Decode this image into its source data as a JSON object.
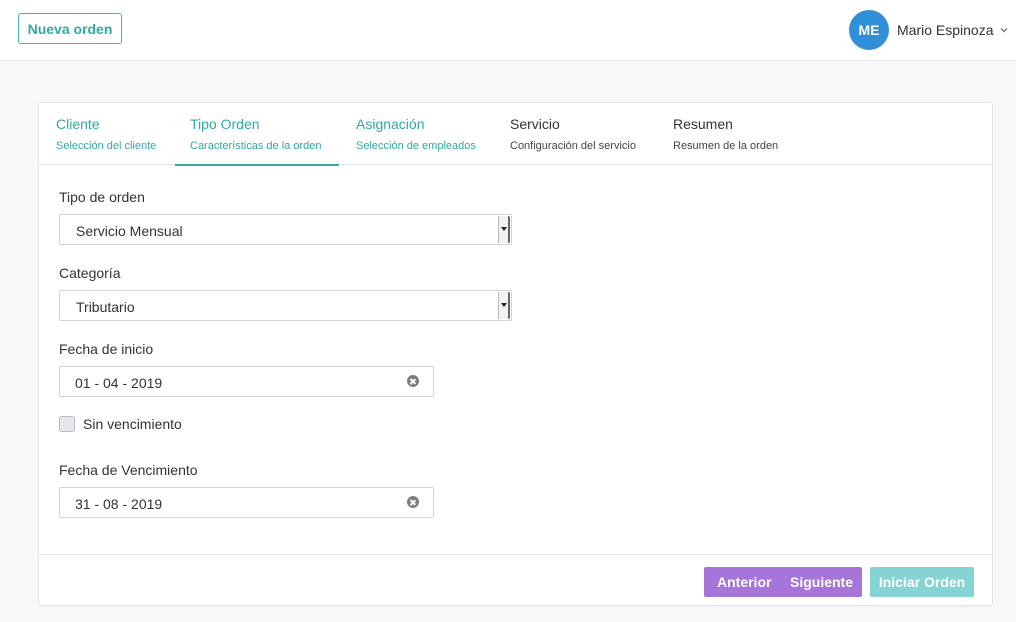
{
  "header": {
    "new_order_label": "Nueva orden",
    "user": {
      "initials": "ME",
      "name": "Mario Espinoza"
    }
  },
  "steps": [
    {
      "title": "Cliente",
      "subtitle": "Selección del cliente",
      "state": "done"
    },
    {
      "title": "Tipo Orden",
      "subtitle": "Características de la orden",
      "state": "active"
    },
    {
      "title": "Asignación",
      "subtitle": "Selección de empleados",
      "state": "done"
    },
    {
      "title": "Servicio",
      "subtitle": "Configuración del servicio",
      "state": "todo"
    },
    {
      "title": "Resumen",
      "subtitle": "Resumen de la orden",
      "state": "todo"
    }
  ],
  "form": {
    "order_type": {
      "label": "Tipo de orden",
      "value": "Servicio Mensual"
    },
    "category": {
      "label": "Categoría",
      "value": "Tributario"
    },
    "start_date": {
      "label": "Fecha de inicio",
      "value": "01 - 04 - 2019"
    },
    "no_expiry": {
      "label": "Sin vencimiento",
      "checked": false
    },
    "expiry_date": {
      "label": "Fecha de Vencimiento",
      "value": "31 - 08 - 2019"
    }
  },
  "footer": {
    "prev_label": "Anterior",
    "next_label": "Siguiente",
    "start_label": "Iniciar Orden"
  },
  "colors": {
    "accent": "#30a9a4",
    "avatar": "#2f8fd8",
    "nav_buttons": "#a774d9",
    "start_button": "#86d3d4"
  }
}
